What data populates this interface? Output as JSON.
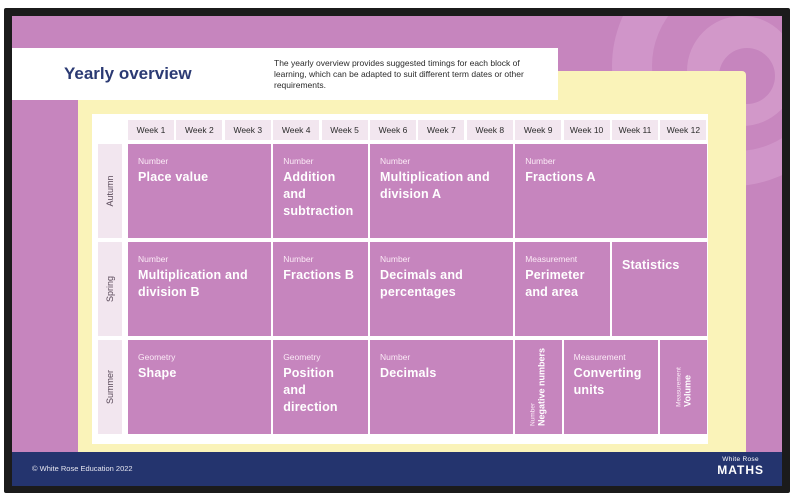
{
  "header": {
    "title": "Yearly overview",
    "intro": "The yearly overview provides suggested timings for each block of learning, which can be adapted to suit different term dates or other requirements."
  },
  "weeks": [
    "Week 1",
    "Week 2",
    "Week 3",
    "Week 4",
    "Week 5",
    "Week 6",
    "Week 7",
    "Week 8",
    "Week 9",
    "Week 10",
    "Week 11",
    "Week 12"
  ],
  "terms": [
    "Autumn",
    "Spring",
    "Summer"
  ],
  "autumn": [
    {
      "category": "Number",
      "name": "Place value",
      "weeks": 3
    },
    {
      "category": "Number",
      "name": "Addition and subtraction",
      "weeks": 2
    },
    {
      "category": "Number",
      "name": "Multiplication and division A",
      "weeks": 3
    },
    {
      "category": "Number",
      "name": "Fractions A",
      "weeks": 4
    }
  ],
  "spring": [
    {
      "category": "Number",
      "name": "Multiplication and division B",
      "weeks": 3
    },
    {
      "category": "Number",
      "name": "Fractions B",
      "weeks": 2
    },
    {
      "category": "Number",
      "name": "Decimals and percentages",
      "weeks": 3
    },
    {
      "category": "Measurement",
      "name": "Perimeter and area",
      "weeks": 2
    },
    {
      "category": "",
      "name": "Statistics",
      "weeks": 2
    }
  ],
  "summer": [
    {
      "category": "Geometry",
      "name": "Shape",
      "weeks": 3
    },
    {
      "category": "Geometry",
      "name": "Position and direction",
      "weeks": 2
    },
    {
      "category": "Number",
      "name": "Decimals",
      "weeks": 3
    },
    {
      "category": "Number",
      "name": "Negative numbers",
      "weeks": 1,
      "vertical": true
    },
    {
      "category": "Measurement",
      "name": "Converting units",
      "weeks": 2
    },
    {
      "category": "Measurement",
      "name": "Volume",
      "weeks": 1,
      "vertical": true
    }
  ],
  "footer": {
    "copyright": "© White Rose Education 2022",
    "logo_top": "White Rose",
    "logo_main": "MATHS"
  }
}
